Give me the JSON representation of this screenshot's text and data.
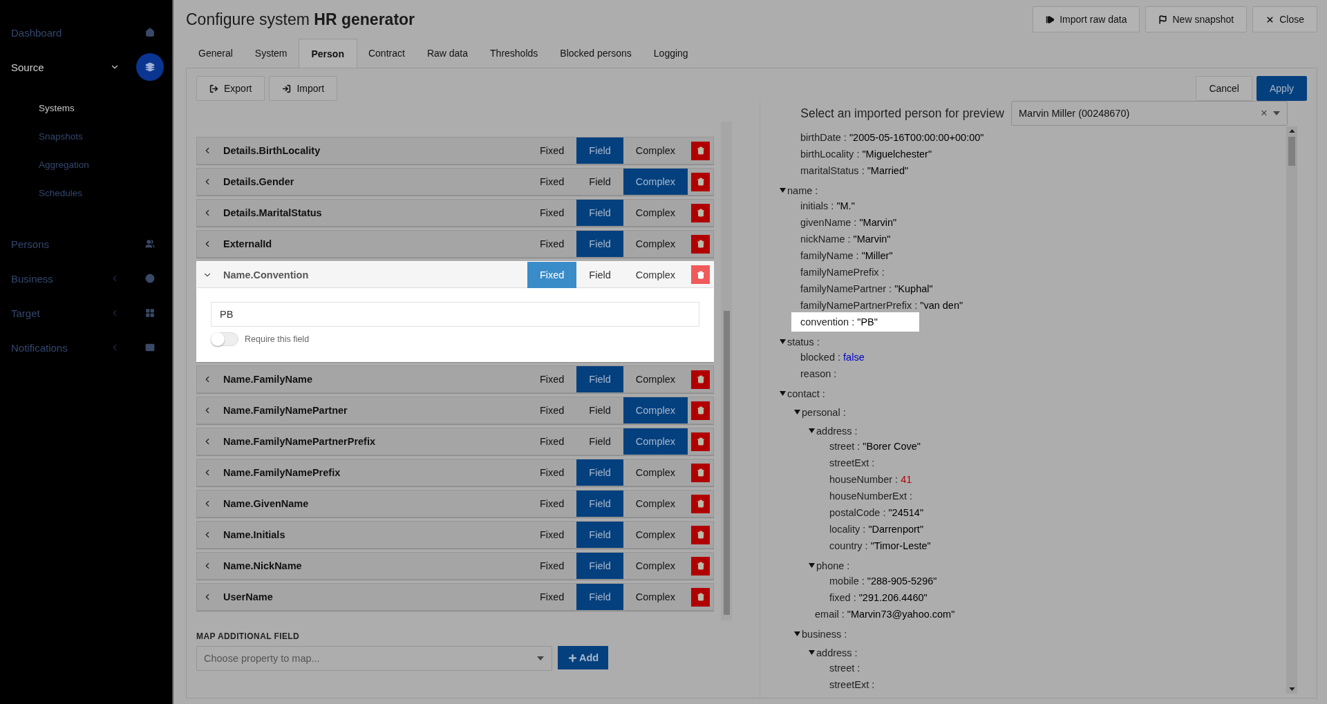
{
  "sidebar": {
    "items": [
      {
        "label": "Dashboard",
        "selected": false
      },
      {
        "label": "Source",
        "selected": true,
        "expanded": true,
        "children": [
          {
            "label": "Systems",
            "selected": true
          },
          {
            "label": "Snapshots",
            "selected": false
          },
          {
            "label": "Aggregation",
            "selected": false
          },
          {
            "label": "Schedules",
            "selected": false
          }
        ]
      },
      {
        "label": "Persons",
        "selected": false
      },
      {
        "label": "Business",
        "selected": false,
        "expanded": false
      },
      {
        "label": "Target",
        "selected": false,
        "expanded": false
      },
      {
        "label": "Notifications",
        "selected": false,
        "expanded": false
      }
    ]
  },
  "header": {
    "title": "Configure system **HR generator**",
    "buttons": [
      "Import raw data",
      "New snapshot",
      "Close"
    ]
  },
  "tabs": [
    {
      "label": "General",
      "selected": false
    },
    {
      "label": "System",
      "selected": false
    },
    {
      "label": "Person",
      "selected": true
    },
    {
      "label": "Contract",
      "selected": false
    },
    {
      "label": "Raw data",
      "selected": false
    },
    {
      "label": "Thresholds",
      "selected": false
    },
    {
      "label": "Blocked persons",
      "selected": false
    },
    {
      "label": "Logging",
      "selected": false
    }
  ],
  "toolbar": {
    "left": [
      "Export",
      "Import"
    ],
    "cancel": "Cancel",
    "apply": "Apply"
  },
  "mappings": [
    {
      "name": "Details.BirthLocality",
      "expanded": false,
      "modes": [
        {
          "label": "Fixed",
          "selected": false
        },
        {
          "label": "Field",
          "selected": true
        },
        {
          "label": "Complex",
          "selected": false
        }
      ]
    },
    {
      "name": "Details.Gender",
      "expanded": false,
      "modes": [
        {
          "label": "Fixed",
          "selected": false
        },
        {
          "label": "Field",
          "selected": false
        },
        {
          "label": "Complex",
          "selected": true
        }
      ]
    },
    {
      "name": "Details.MaritalStatus",
      "expanded": false,
      "modes": [
        {
          "label": "Fixed",
          "selected": false
        },
        {
          "label": "Field",
          "selected": true
        },
        {
          "label": "Complex",
          "selected": false
        }
      ]
    },
    {
      "name": "ExternalId",
      "expanded": false,
      "modes": [
        {
          "label": "Fixed",
          "selected": false
        },
        {
          "label": "Field",
          "selected": true
        },
        {
          "label": "Complex",
          "selected": false
        }
      ]
    },
    {
      "name": "Name.Convention",
      "expanded": true,
      "value": "PB",
      "require": {
        "label": "Require this field",
        "on": false
      },
      "modes": [
        {
          "label": "Fixed",
          "selected": true
        },
        {
          "label": "Field",
          "selected": false
        },
        {
          "label": "Complex",
          "selected": false
        }
      ]
    },
    {
      "name": "Name.FamilyName",
      "expanded": false,
      "modes": [
        {
          "label": "Fixed",
          "selected": false
        },
        {
          "label": "Field",
          "selected": true
        },
        {
          "label": "Complex",
          "selected": false
        }
      ]
    },
    {
      "name": "Name.FamilyNamePartner",
      "expanded": false,
      "modes": [
        {
          "label": "Fixed",
          "selected": false
        },
        {
          "label": "Field",
          "selected": false
        },
        {
          "label": "Complex",
          "selected": true
        }
      ]
    },
    {
      "name": "Name.FamilyNamePartnerPrefix",
      "expanded": false,
      "modes": [
        {
          "label": "Fixed",
          "selected": false
        },
        {
          "label": "Field",
          "selected": false
        },
        {
          "label": "Complex",
          "selected": true
        }
      ]
    },
    {
      "name": "Name.FamilyNamePrefix",
      "expanded": false,
      "modes": [
        {
          "label": "Fixed",
          "selected": false
        },
        {
          "label": "Field",
          "selected": true
        },
        {
          "label": "Complex",
          "selected": false
        }
      ]
    },
    {
      "name": "Name.GivenName",
      "expanded": false,
      "modes": [
        {
          "label": "Fixed",
          "selected": false
        },
        {
          "label": "Field",
          "selected": true
        },
        {
          "label": "Complex",
          "selected": false
        }
      ]
    },
    {
      "name": "Name.Initials",
      "expanded": false,
      "modes": [
        {
          "label": "Fixed",
          "selected": false
        },
        {
          "label": "Field",
          "selected": true
        },
        {
          "label": "Complex",
          "selected": false
        }
      ]
    },
    {
      "name": "Name.NickName",
      "expanded": false,
      "modes": [
        {
          "label": "Fixed",
          "selected": false
        },
        {
          "label": "Field",
          "selected": true
        },
        {
          "label": "Complex",
          "selected": false
        }
      ]
    },
    {
      "name": "UserName",
      "expanded": false,
      "modes": [
        {
          "label": "Fixed",
          "selected": false
        },
        {
          "label": "Field",
          "selected": true
        },
        {
          "label": "Complex",
          "selected": false
        }
      ]
    }
  ],
  "map_additional": {
    "label": "MAP ADDITIONAL FIELD",
    "placeholder": "Choose property to map...",
    "button": "Add"
  },
  "preview": {
    "label": "Select an imported person for preview",
    "value": "Marvin Miller (00248670)",
    "clear": "×"
  },
  "tree": [
    {
      "key": "birthDate :",
      "value": "\"2005-05-16T00:00:00+00:00\"",
      "kind": "string"
    },
    {
      "key": "birthLocality :",
      "value": "\"Miguelchester\"",
      "kind": "string"
    },
    {
      "key": "maritalStatus :",
      "value": "\"Married\"",
      "kind": "string"
    },
    {
      "key": "name :",
      "expanded": true,
      "children": [
        {
          "key": "initials :",
          "value": "\"M.\"",
          "kind": "string"
        },
        {
          "key": "givenName :",
          "value": "\"Marvin\"",
          "kind": "string"
        },
        {
          "key": "nickName :",
          "value": "\"Marvin\"",
          "kind": "string"
        },
        {
          "key": "familyName :",
          "value": "\"Miller\"",
          "kind": "string"
        },
        {
          "key": "familyNamePrefix :"
        },
        {
          "key": "familyNamePartner :",
          "value": "\"Kuphal\"",
          "kind": "string"
        },
        {
          "key": "familyNamePartnerPrefix :",
          "value": "\"van den\"",
          "kind": "string"
        },
        {
          "key": "convention :",
          "value": "\"PB\"",
          "kind": "string",
          "highlighted": true
        }
      ]
    },
    {
      "key": "status :",
      "expanded": true,
      "children": [
        {
          "key": "blocked :",
          "value": "false",
          "kind": "boolean"
        },
        {
          "key": "reason :"
        }
      ]
    },
    {
      "key": "contact :",
      "expanded": true,
      "children": [
        {
          "key": "personal :",
          "expanded": true,
          "children": [
            {
              "key": "address :",
              "expanded": true,
              "children": [
                {
                  "key": "street :",
                  "value": "\"Borer Cove\"",
                  "kind": "string"
                },
                {
                  "key": "streetExt :"
                },
                {
                  "key": "houseNumber :",
                  "value": "41",
                  "kind": "number"
                },
                {
                  "key": "houseNumberExt :"
                },
                {
                  "key": "postalCode :",
                  "value": "\"24514\"",
                  "kind": "string"
                },
                {
                  "key": "locality :",
                  "value": "\"Darrenport\"",
                  "kind": "string"
                },
                {
                  "key": "country :",
                  "value": "\"Timor-Leste\"",
                  "kind": "string"
                }
              ]
            },
            {
              "key": "phone :",
              "expanded": true,
              "children": [
                {
                  "key": "mobile :",
                  "value": "\"288-905-5296\"",
                  "kind": "string"
                },
                {
                  "key": "fixed :",
                  "value": "\"291.206.4460\"",
                  "kind": "string"
                }
              ]
            },
            {
              "key": "email :",
              "value": "\"Marvin73@yahoo.com\"",
              "kind": "string"
            }
          ]
        },
        {
          "key": "business :",
          "expanded": true,
          "children": [
            {
              "key": "address :",
              "expanded": true,
              "children": [
                {
                  "key": "street :"
                },
                {
                  "key": "streetExt :"
                }
              ]
            }
          ]
        }
      ]
    }
  ]
}
